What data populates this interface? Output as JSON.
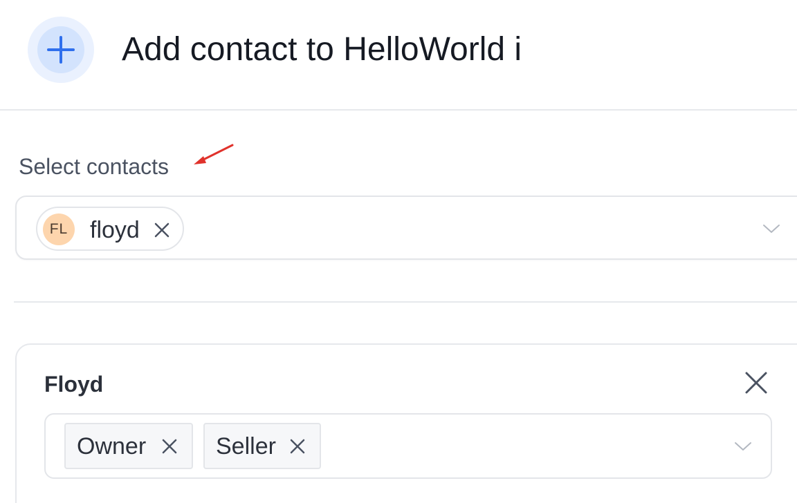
{
  "header": {
    "icon": "plus-icon",
    "title": "Add contact to HelloWorld i"
  },
  "select_contacts": {
    "label": "Select contacts",
    "selected": [
      {
        "initials": "FL",
        "name": "floyd"
      }
    ],
    "dropdown_icon": "chevron-down-icon"
  },
  "contact_card": {
    "title": "Floyd",
    "close_icon": "close-icon",
    "roles": [
      "Owner",
      "Seller"
    ],
    "dropdown_icon": "chevron-down-icon"
  },
  "colors": {
    "accent": "#2f6fed",
    "avatar_bg": "#fdd5ad",
    "annotation_arrow": "#e0322b"
  }
}
